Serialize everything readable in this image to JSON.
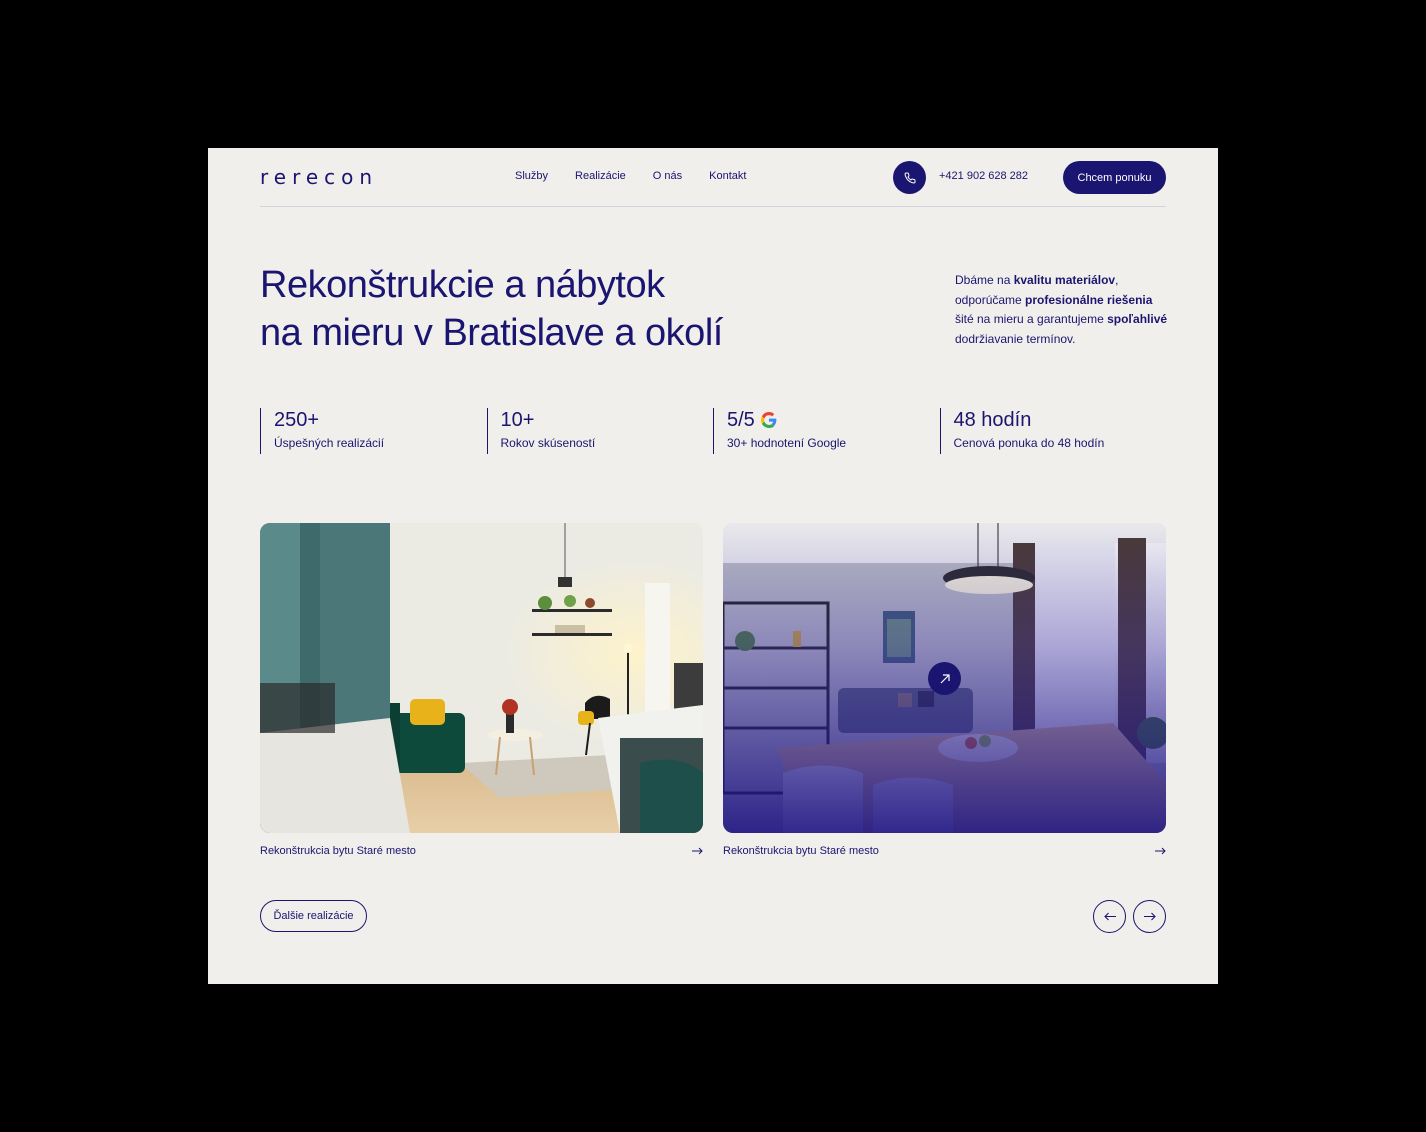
{
  "header": {
    "logo": "rerecon",
    "nav": [
      "Služby",
      "Realizácie",
      "O nás",
      "Kontakt"
    ],
    "phone": "+421 902 628 282",
    "cta_label": "Chcem ponuku"
  },
  "hero": {
    "title_line1": "Rekonštrukcie a nábytok",
    "title_line2": "na mieru v Bratislave a okolí",
    "desc": {
      "p1": "Dbáme na ",
      "b1": "kvalitu materiálov",
      "p2": ", odporúčame ",
      "b2": "profesionálne riešenia",
      "p3": " šité na mieru a garantujeme ",
      "b3": "spoľahlivé",
      "p4": " dodržiavanie termínov."
    }
  },
  "stats": [
    {
      "value": "250+",
      "label": "Úspešných realizácií"
    },
    {
      "value": "10+",
      "label": "Rokov skúseností"
    },
    {
      "value": "5/5",
      "label": "30+ hodnotení Google",
      "icon": "google-icon"
    },
    {
      "value": "48 hodín",
      "label": "Cenová ponuka do 48 hodín"
    }
  ],
  "projects": [
    {
      "caption": "Rekonštrukcia bytu Staré mesto"
    },
    {
      "caption": "Rekonštrukcia bytu Staré mesto"
    }
  ],
  "footer": {
    "more_label": "Ďalšie realizácie"
  },
  "colors": {
    "brand": "#1a1570",
    "background": "#f0efeb"
  }
}
